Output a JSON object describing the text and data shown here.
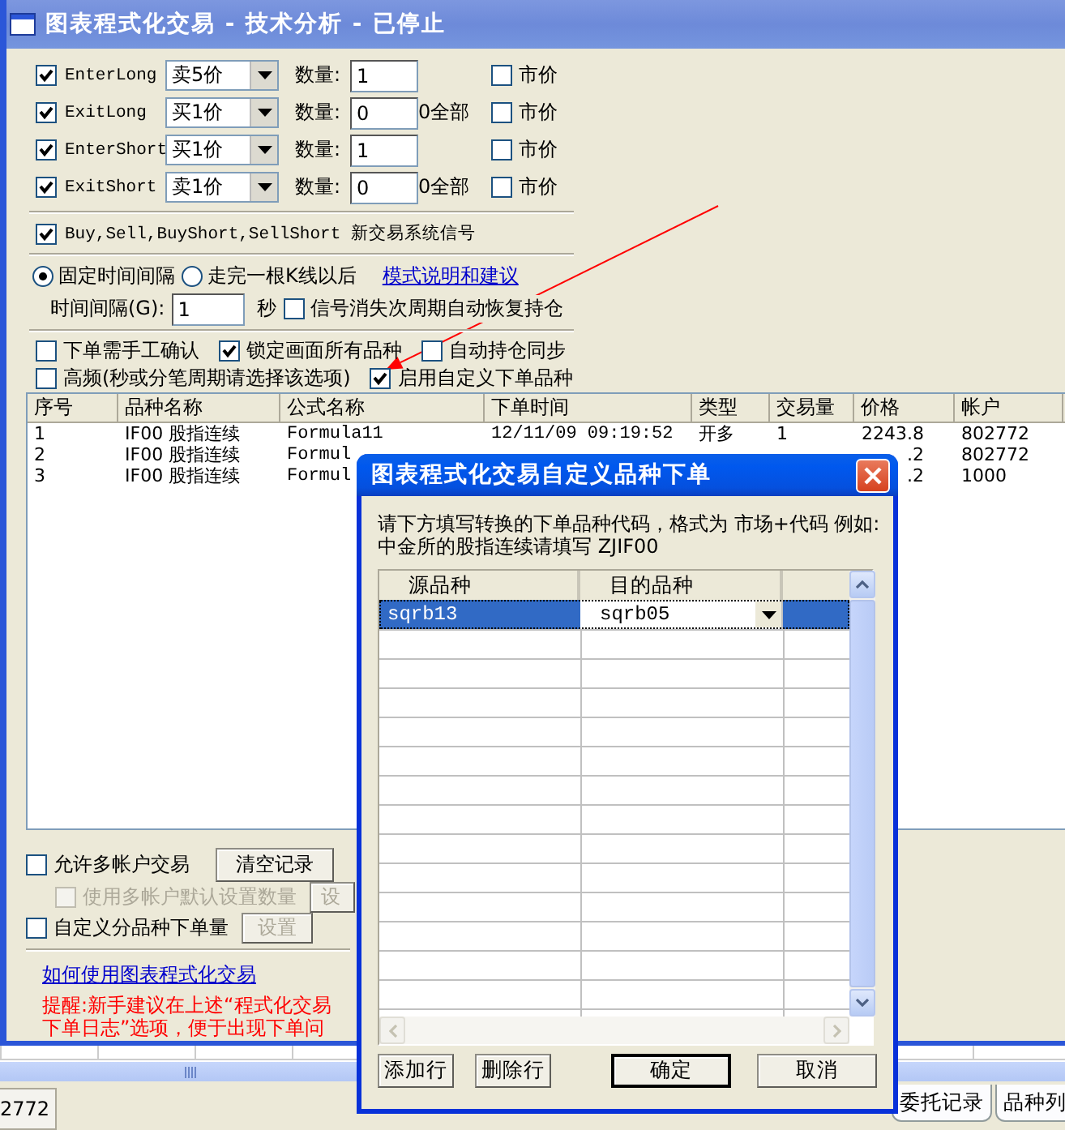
{
  "window": {
    "title": "图表程式化交易 - 技术分析 - 已停止"
  },
  "signal_rows": [
    {
      "checked": true,
      "name": "EnterLong",
      "price": "卖5价",
      "qty_label": "数量:",
      "qty": "1",
      "market": {
        "label": "市价",
        "checked": false
      }
    },
    {
      "checked": true,
      "name": "ExitLong",
      "price": "买1价",
      "qty_label": "数量:",
      "qty": "0",
      "all_note": "0全部",
      "market": {
        "label": "市价",
        "checked": false
      }
    },
    {
      "checked": true,
      "name": "EnterShort",
      "price": "买1价",
      "qty_label": "数量:",
      "qty": "1",
      "market": {
        "label": "市价",
        "checked": false
      }
    },
    {
      "checked": true,
      "name": "ExitShort",
      "price": "卖1价",
      "qty_label": "数量:",
      "qty": "0",
      "all_note": "0全部",
      "market": {
        "label": "市价",
        "checked": false
      }
    }
  ],
  "new_signals": {
    "label": "Buy,Sell,BuyShort,SellShort 新交易系统信号",
    "checked": true
  },
  "timing": {
    "modes": [
      {
        "label": "固定时间间隔",
        "selected": true
      },
      {
        "label": "走完一根K线以后",
        "selected": false
      }
    ],
    "help_link": "模式说明和建议",
    "interval_label": "时间间隔(G):",
    "interval": "1",
    "unit": "秒",
    "restore": {
      "label": "信号消失次周期自动恢复持仓",
      "checked": false
    }
  },
  "options": [
    [
      {
        "label": "下单需手工确认",
        "checked": false
      },
      {
        "label": "锁定画面所有品种",
        "checked": true
      },
      {
        "label": "自动持仓同步",
        "checked": false
      }
    ],
    [
      {
        "label": "高频(秒或分笔周期请选择该选项)",
        "checked": false
      },
      {
        "label": "启用自定义下单品种",
        "checked": true
      }
    ]
  ],
  "orders": {
    "columns": [
      "序号",
      "品种名称",
      "公式名称",
      "下单时间",
      "类型",
      "交易量",
      "价格",
      "帐户"
    ],
    "rows": [
      [
        "1",
        "IF00 股指连续",
        "Formula11",
        "12/11/09 09:19:52",
        "开多",
        "1",
        "2243.8",
        "802772"
      ],
      [
        "2",
        "IF00 股指连续",
        "Formul",
        "",
        "",
        "",
        ".2",
        "802772"
      ],
      [
        "3",
        "IF00 股指连续",
        "Formul",
        "",
        "",
        "",
        ".2",
        "1000"
      ]
    ]
  },
  "multi_account": {
    "label": "允许多帐户交易",
    "checked": false,
    "button": "清空记录"
  },
  "default_qty": {
    "label": "使用多帐户默认设置数量",
    "checked": false,
    "disabled": true,
    "button": "设"
  },
  "custom_qty": {
    "label": "自定义分品种下单量",
    "checked": false,
    "button": "设置"
  },
  "guide_link": "如何使用图表程式化交易",
  "reminder": [
    "提醒:新手建议在上述“程式化交易",
    "下单日志”选项，便于出现下单问"
  ],
  "status_bar": {
    "account_cell": "2772",
    "tabs": [
      {
        "label": "委托记录",
        "selected": false
      },
      {
        "label": "品种列",
        "selected": false
      }
    ]
  },
  "dialog": {
    "title": "图表程式化交易自定义品种下单",
    "instructions": [
      "请下方填写转换的下单品种代码，格式为 市场+代码 例如:",
      "中金所的股指连续请填写 ZJIF00"
    ],
    "columns": [
      "源品种",
      "目的品种"
    ],
    "rows": [
      {
        "source": "sqrb13",
        "target": "sqrb05",
        "selected": true
      }
    ],
    "buttons": [
      {
        "label": "添加行",
        "default": false
      },
      {
        "label": "删除行",
        "default": false
      },
      {
        "label": "确定",
        "default": true
      },
      {
        "label": "取消",
        "default": false
      }
    ]
  }
}
